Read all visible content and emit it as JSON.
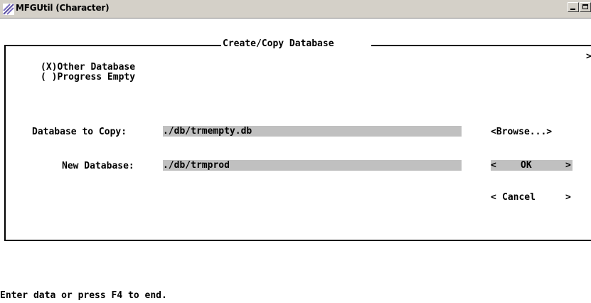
{
  "window": {
    "title": "MFGUtil (Character)",
    "app_icon": "mfg-app-icon",
    "controls": {
      "minimize": "minimize-icon",
      "maximize": "maximize-icon",
      "close": "×"
    }
  },
  "dialog": {
    "title": "Create/Copy Database",
    "options": [
      {
        "label": "(X)Other Database",
        "selected": true
      },
      {
        "label": "( )Progress Empty",
        "selected": false
      }
    ],
    "fields": {
      "copy_label": "Database to Copy:",
      "copy_value": "./db/trmempty.db",
      "new_label": "New Database:",
      "new_value": "./db/trmprod"
    },
    "buttons": {
      "browse": "<Browse...>",
      "ok_left": "<",
      "ok": "OK",
      "ok_right": ">",
      "cancel_left": "<",
      "cancel": "Cancel",
      "cancel_right": ">"
    },
    "edge_mark": ">"
  },
  "status": "Enter data or press F4 to end.",
  "colors": {
    "titlebar": "#d4d0c8",
    "field_bg": "#c0c0c0",
    "background": "#ffffff",
    "text": "#000000"
  }
}
